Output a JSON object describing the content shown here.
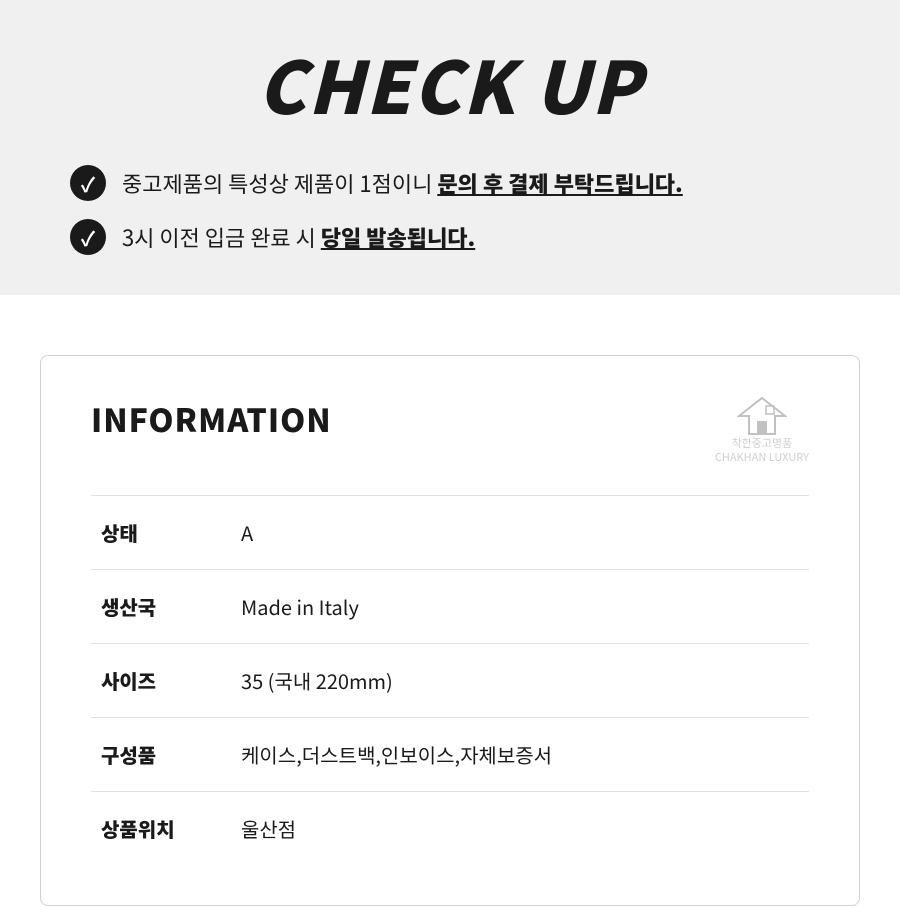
{
  "header": {
    "title": "CHECK UP",
    "background_color": "#f0f0f0"
  },
  "check_items": [
    {
      "id": "item1",
      "text_before": "중고제품의 특성상 제품이 1점이니 ",
      "text_bold": "문의 후 결제 부탁드립니다."
    },
    {
      "id": "item2",
      "text_before": "3시 이전 입금 완료 시 ",
      "text_bold": "당일 발송됩니다."
    }
  ],
  "information": {
    "section_title": "INFORMATION",
    "brand_logo_line1": "착한중고명품",
    "brand_logo_line2": "CHAKHAN LUXURY",
    "rows": [
      {
        "label": "상태",
        "value": "A"
      },
      {
        "label": "생산국",
        "value": "Made in Italy"
      },
      {
        "label": "사이즈",
        "value": "35 (국내 220mm)"
      },
      {
        "label": "구성품",
        "value": "케이스,더스트백,인보이스,자체보증서"
      },
      {
        "label": "상품위치",
        "value": "울산점"
      }
    ]
  }
}
